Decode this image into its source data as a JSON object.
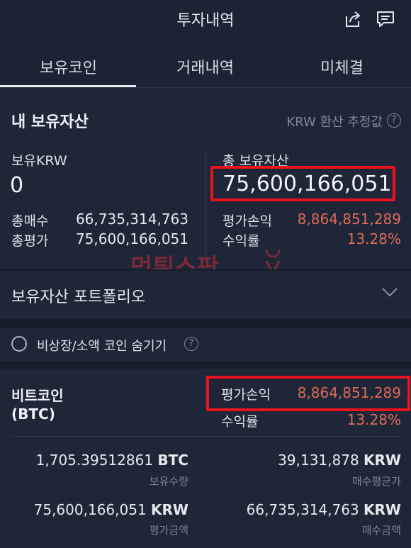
{
  "header": {
    "title": "투자내역"
  },
  "tabs": [
    {
      "label": "보유코인"
    },
    {
      "label": "거래내역"
    },
    {
      "label": "미체결"
    }
  ],
  "assets": {
    "title": "내 보유자산",
    "krw_note": "KRW 환산 추정값",
    "krw_label": "보유KRW",
    "krw_value": "0",
    "total_label": "총 보유자산",
    "total_value": "75,600,166,051",
    "total_buy_label": "총매수",
    "total_buy_value": "66,735,314,763",
    "total_eval_label": "총평가",
    "total_eval_value": "75,600,166,051",
    "pl_label": "평가손익",
    "pl_value": "8,864,851,289",
    "rate_label": "수익률",
    "rate_value": "13.28%"
  },
  "portfolio": {
    "label": "보유자산 포트폴리오"
  },
  "hide_option": {
    "label": "비상장/소액 코인 숨기기"
  },
  "coin": {
    "name": "비트코인",
    "symbol": "(BTC)",
    "pl_label": "평가손익",
    "pl_value": "8,864,851,289",
    "rate_label": "수익률",
    "rate_value": "13.28%",
    "qty_value": "1,705.39512861",
    "qty_unit": "BTC",
    "qty_label": "보유수량",
    "avg_value": "39,131,878",
    "avg_unit": "KRW",
    "avg_label": "매수평균가",
    "eval_value": "75,600,166,051",
    "eval_unit": "KRW",
    "eval_label": "평가금액",
    "buy_value": "66,735,314,763",
    "buy_unit": "KRW",
    "buy_label": "매수금액"
  },
  "watermark": {
    "text": "먹튀스팟"
  },
  "colors": {
    "accent_red": "#e26b5a",
    "highlight_box": "#e8131c",
    "background": "#1e2637"
  }
}
